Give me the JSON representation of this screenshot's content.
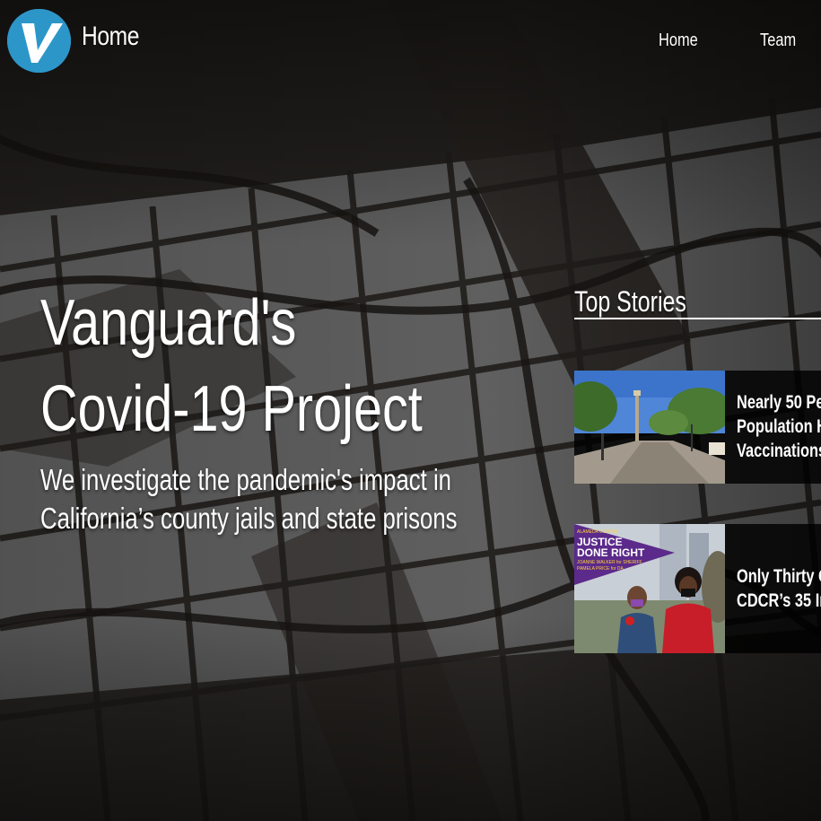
{
  "header": {
    "logo_letter": "V",
    "site_title": "Home",
    "nav": [
      "Home",
      "Team"
    ]
  },
  "hero": {
    "title_lines": [
      "Vanguard's",
      "Covid-19 Project"
    ],
    "subtitle_lines": [
      "We investigate the pandemic's impact in",
      "California’s county jails and state prisons"
    ]
  },
  "top_stories": {
    "heading": "Top Stories",
    "items": [
      {
        "title_lines": [
          "Nearly 50 Pe",
          "Population H",
          "Vaccinations"
        ]
      },
      {
        "title_lines": [
          "Only Thirty O",
          "CDCR’s 35 In"
        ]
      }
    ],
    "poster_text": [
      "ALAMEDA COUNTY",
      "JUSTICE",
      "DONE RIGHT",
      "JOANNE WALKER for SHERIFF",
      "PAMELA PRICE for DA"
    ]
  },
  "colors": {
    "logo": "#2d96c9",
    "poster_purple": "#5b2a8a",
    "story_panel": "#000000"
  }
}
